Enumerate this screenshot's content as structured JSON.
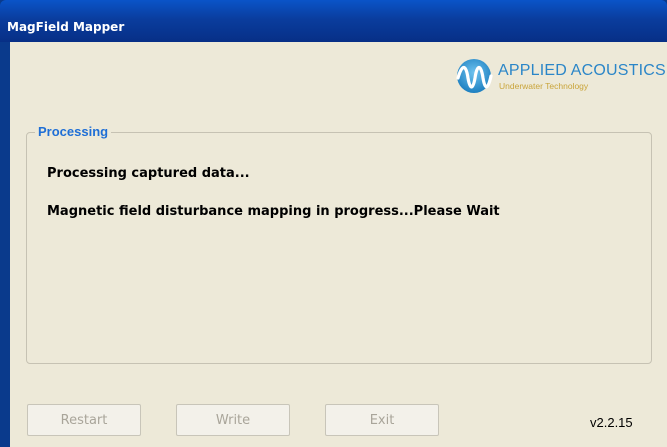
{
  "window": {
    "title": "MagField Mapper",
    "version": "v2.2.15"
  },
  "logo": {
    "name": "APPLIED ACOUSTICS",
    "tagline": "Underwater Technology",
    "icon": "applied-acoustics-logo-icon"
  },
  "processing": {
    "group_title": "Processing",
    "line1": "Processing captured data...",
    "line2": "Magnetic field disturbance mapping in progress...Please Wait"
  },
  "buttons": {
    "restart": "Restart",
    "write": "Write",
    "exit": "Exit",
    "state": "disabled"
  },
  "colors": {
    "titlebar": "#0a3d9e",
    "client_bg": "#ede9d8",
    "group_title": "#1f6fd6",
    "logo_blue": "#2b86c8",
    "logo_gold": "#c9a43a",
    "disabled_text": "#a9a59a"
  }
}
